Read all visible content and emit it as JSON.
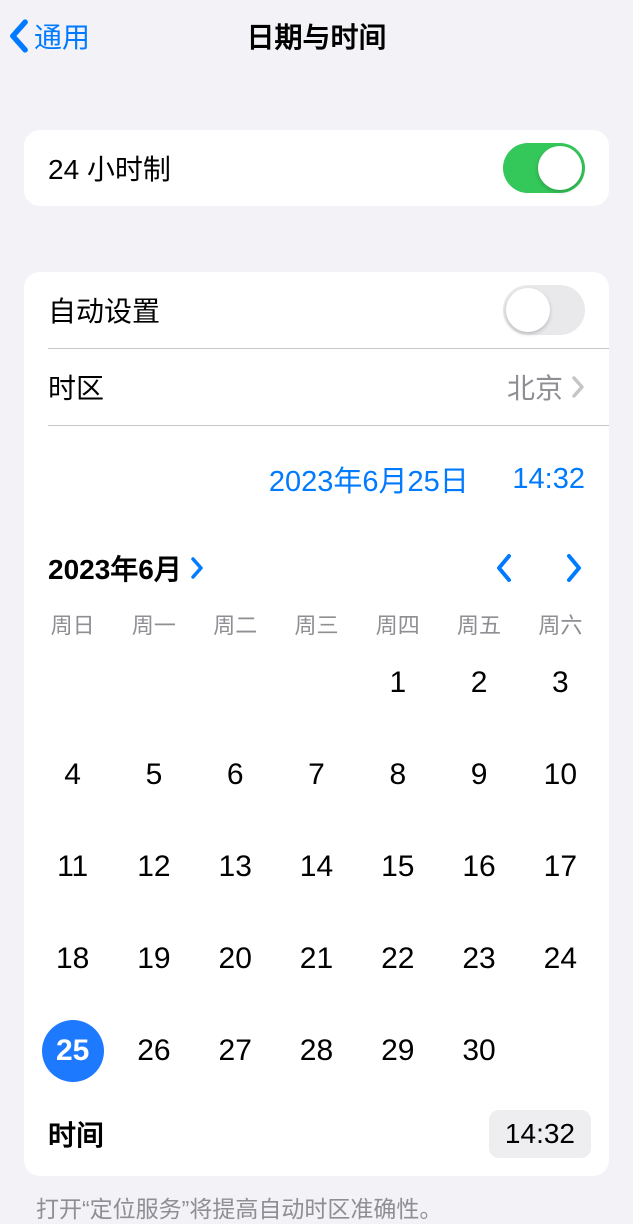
{
  "nav": {
    "back": "通用",
    "title": "日期与时间"
  },
  "hour24": {
    "label": "24 小时制",
    "on": true
  },
  "autoSet": {
    "label": "自动设置",
    "on": false
  },
  "timezone": {
    "label": "时区",
    "value": "北京"
  },
  "picker": {
    "date": "2023年6月25日",
    "time": "14:32"
  },
  "calendar": {
    "monthTitle": "2023年6月",
    "weekdays": [
      "周日",
      "周一",
      "周二",
      "周三",
      "周四",
      "周五",
      "周六"
    ],
    "firstWeekdayIndex": 4,
    "daysInMonth": 30,
    "selectedDay": 25
  },
  "timeRow": {
    "label": "时间",
    "value": "14:32"
  },
  "footer": "打开“定位服务”将提高自动时区准确性。"
}
